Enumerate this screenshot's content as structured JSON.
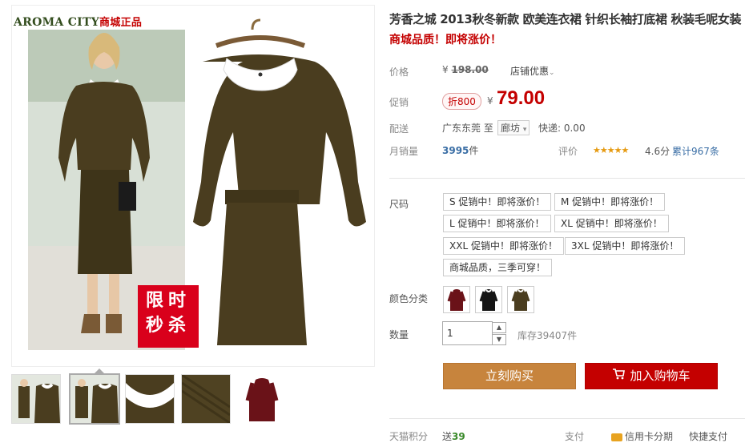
{
  "gallery": {
    "brand": "AROMA CITY",
    "brand_cn": "商城正品",
    "stamp_line1": "限时",
    "stamp_line2": "秒杀",
    "thumbnails": [
      "thumb-1",
      "thumb-2",
      "thumb-3",
      "thumb-4",
      "thumb-5"
    ],
    "active_thumb": 1
  },
  "product": {
    "title": "芳香之城 2013秋冬新款 欧美连衣裙 针织长袖打底裙 秋装毛呢女装",
    "subtitle": "商城品质！即将涨价！",
    "price_label": "价格",
    "original_currency": "¥",
    "original_price": "198.00",
    "store_discount": "店铺优惠",
    "promo_label": "促销",
    "promo_badge": "折800",
    "promo_currency": "¥",
    "promo_price": "79.00",
    "shipping_label": "配送",
    "ship_from": "广东东莞",
    "ship_to_word": "至",
    "ship_to": "廊坊",
    "express": "快递: 0.00",
    "monthly_label": "月销量",
    "monthly_sales": "3995",
    "monthly_unit": "件",
    "rating_label": "评价",
    "stars": "★★★★★",
    "rating": "4.6分",
    "reviews": "累计967条"
  },
  "size": {
    "label": "尺码",
    "options": [
      "S 促销中！即将涨价！",
      "M 促销中！即将涨价！",
      "L 促销中！即将涨价！",
      "XL 促销中！即将涨价！",
      "XXL 促销中！即将涨价！",
      "3XL 促销中！即将涨价！",
      "商城品质，三季可穿！"
    ]
  },
  "color": {
    "label": "颜色分类",
    "swatches": [
      "wine-red",
      "black",
      "army-green"
    ]
  },
  "quantity": {
    "label": "数量",
    "value": "1",
    "stock": "库存39407件"
  },
  "actions": {
    "buy_now": "立刻购买",
    "add_to_cart": "加入购物车"
  },
  "footer": {
    "points_label": "天猫积分",
    "points_prefix": "送",
    "points": "39",
    "pay_label": "支付",
    "credit": "信用卡分期",
    "quick_pay": "快捷支付"
  },
  "colors": {
    "accent_red": "#c40000",
    "buy_orange": "#c7843d",
    "link_blue": "#3a6ea5",
    "dress_brown": "#4a3d1f"
  }
}
